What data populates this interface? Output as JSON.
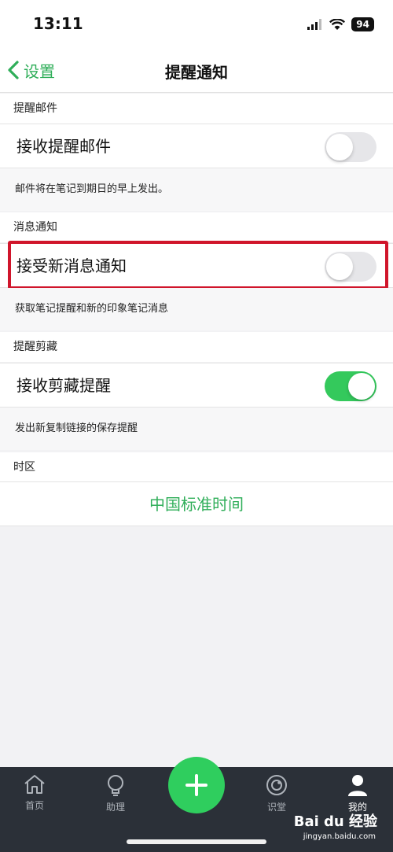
{
  "status_bar": {
    "time": "13:11",
    "battery": "94"
  },
  "nav": {
    "back_label": "设置",
    "title": "提醒通知"
  },
  "sections": [
    {
      "header": "提醒邮件",
      "row_label": "接收提醒邮件",
      "toggle_on": false,
      "note": "邮件将在笔记到期日的早上发出。"
    },
    {
      "header": "消息通知",
      "row_label": "接受新消息通知",
      "toggle_on": false,
      "note": "获取笔记提醒和新的印象笔记消息"
    },
    {
      "header": "提醒剪藏",
      "row_label": "接收剪藏提醒",
      "toggle_on": true,
      "note": "发出新复制链接的保存提醒"
    }
  ],
  "timezone": {
    "header": "时区",
    "value": "中国标准时间"
  },
  "tabbar": {
    "items": [
      {
        "label": "首页",
        "icon": "home-icon"
      },
      {
        "label": "助理",
        "icon": "lightbulb-icon"
      },
      {
        "label": "识堂",
        "icon": "compass-icon"
      },
      {
        "label": "我的",
        "icon": "person-icon"
      }
    ],
    "fab_icon": "plus-icon"
  },
  "watermark": {
    "brand": "Bai du 经验",
    "url": "jingyan.baidu.com"
  },
  "colors": {
    "accent": "#2fae59",
    "toggle_on": "#34c95c",
    "highlight": "#d0152b",
    "tabbar": "#2b3038"
  }
}
